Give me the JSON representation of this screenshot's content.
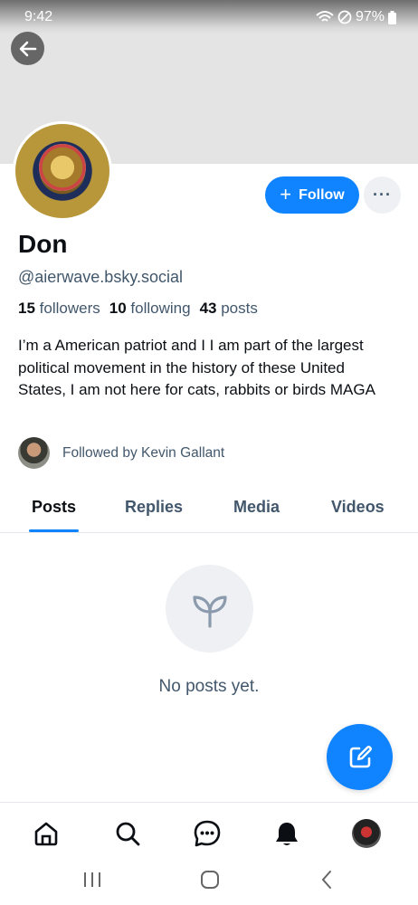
{
  "status_bar": {
    "time": "9:42",
    "battery": "97%"
  },
  "profile": {
    "display_name": "Don",
    "handle": "@aierwave.bsky.social",
    "followers_count": "15",
    "followers_label": "followers",
    "following_count": "10",
    "following_label": "following",
    "posts_count": "43",
    "posts_label": "posts",
    "bio": "I’m a American patriot and I I am part of the largest political movement in the history of these United States, I am not here for cats, rabbits or birds MAGA",
    "followed_by": "Followed by Kevin Gallant"
  },
  "actions": {
    "follow_label": "Follow",
    "more_label": "···"
  },
  "tabs": [
    {
      "label": "Posts",
      "active": true
    },
    {
      "label": "Replies",
      "active": false
    },
    {
      "label": "Media",
      "active": false
    },
    {
      "label": "Videos",
      "active": false
    }
  ],
  "empty_state": {
    "message": "No posts yet."
  },
  "bottom_nav": [
    "home-icon",
    "search-icon",
    "chat-icon",
    "notifications-icon",
    "profile-avatar"
  ],
  "colors": {
    "accent": "#1083fe",
    "muted_text": "#42576c",
    "banner": "#e4e4e4"
  }
}
